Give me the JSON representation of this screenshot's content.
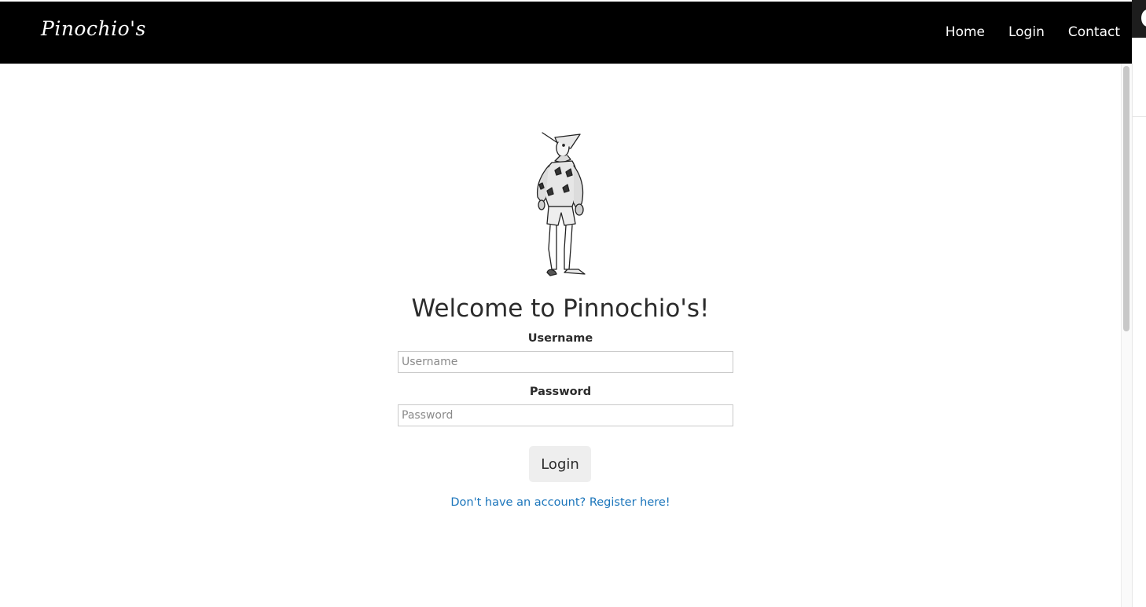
{
  "navbar": {
    "brand": "Pinochio's",
    "links": [
      {
        "label": "Home"
      },
      {
        "label": "Login"
      },
      {
        "label": "Contact"
      }
    ]
  },
  "main": {
    "welcome": "Welcome to Pinnochio's!",
    "username": {
      "label": "Username",
      "placeholder": "Username",
      "value": ""
    },
    "password": {
      "label": "Password",
      "placeholder": "Password",
      "value": ""
    },
    "login_button": "Login",
    "register_link": "Don't have an account? Register here!"
  },
  "colors": {
    "navbar_bg": "#000000",
    "link": "#1b75bb",
    "button_bg": "#eeeeee"
  },
  "icons": {
    "logo_figure": "pinocchio-illustration"
  }
}
